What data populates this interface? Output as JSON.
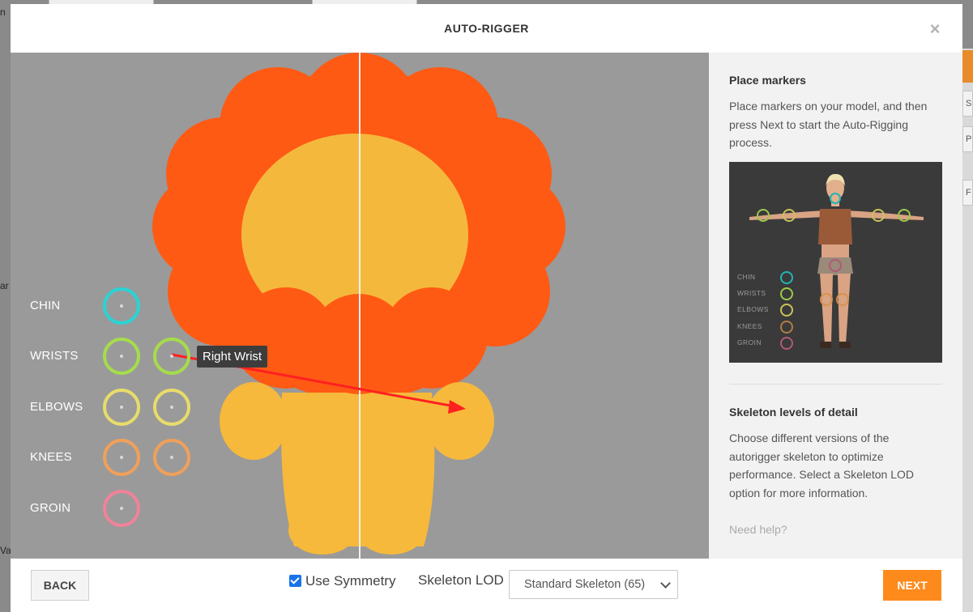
{
  "modal": {
    "title": "AUTO-RIGGER",
    "close_symbol": "×"
  },
  "markers": [
    {
      "label": "CHIN",
      "color": "#29d4d4",
      "count": 1
    },
    {
      "label": "WRISTS",
      "color": "#a6dc4b",
      "count": 2
    },
    {
      "label": "ELBOWS",
      "color": "#e8dc6a",
      "count": 2
    },
    {
      "label": "KNEES",
      "color": "#f0a05a",
      "count": 2
    },
    {
      "label": "GROIN",
      "color": "#f0829a",
      "count": 1
    }
  ],
  "tooltip": {
    "text": "Right Wrist"
  },
  "panel": {
    "place_title": "Place markers",
    "place_text": "Place markers on your model, and then press Next to start the Auto-Rigging process.",
    "preview_legend": [
      {
        "label": "CHIN",
        "color": "#22b5b5"
      },
      {
        "label": "WRISTS",
        "color": "#9dc84a"
      },
      {
        "label": "ELBOWS",
        "color": "#c9c35a"
      },
      {
        "label": "KNEES",
        "color": "#b07d45"
      },
      {
        "label": "GROIN",
        "color": "#b05a72"
      }
    ],
    "lod_title": "Skeleton levels of detail",
    "lod_text": "Choose different versions of the autorigger skeleton to optimize performance. Select a Skeleton LOD option for more information.",
    "help_link": "Need help?"
  },
  "footer": {
    "back_label": "BACK",
    "symmetry_label": "Use Symmetry",
    "symmetry_checked": true,
    "lod_label": "Skeleton LOD",
    "lod_selected": "Standard Skeleton (65)",
    "next_label": "NEXT"
  },
  "background": {
    "right_buttons": [
      "S",
      "PL",
      "F"
    ],
    "left_fragments": [
      "n",
      "ar",
      "Va"
    ]
  },
  "colors": {
    "accent": "#ff8a1c",
    "mane": "#ff5a14",
    "body": "#f6b93b",
    "viewport_bg": "#9a9a9a"
  }
}
